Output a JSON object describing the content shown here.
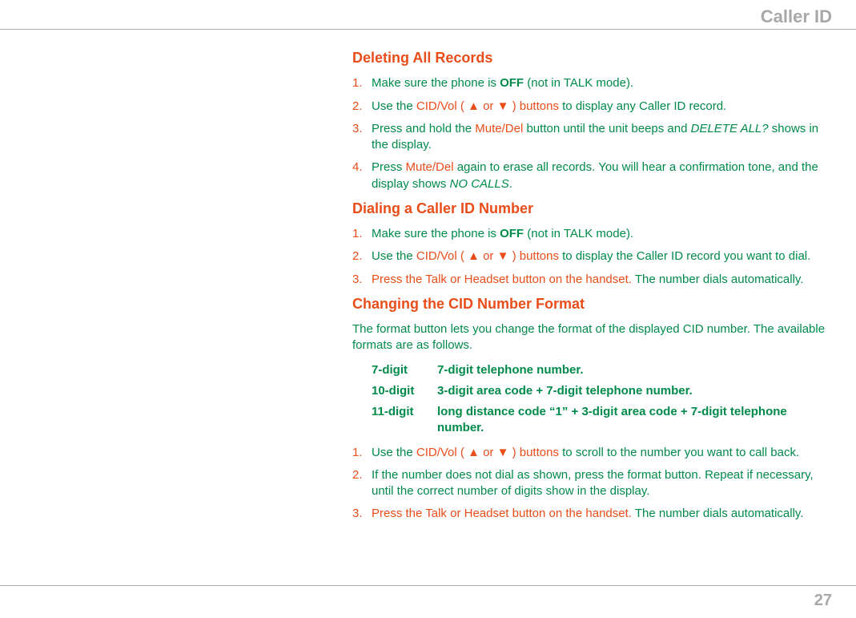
{
  "header": {
    "title": "Caller ID"
  },
  "page_number": "27",
  "sections": {
    "deleting": {
      "heading": "Deleting All Records",
      "items": {
        "1": {
          "num": "1.",
          "pre": "Make sure the phone is ",
          "bold1": "OFF",
          "post": " (not in TALK mode)."
        },
        "2": {
          "num": "2.",
          "pre": "Use the ",
          "red": "CID/Vol ( ▲ or ▼ ) buttons",
          "post": " to display any Caller ID record."
        },
        "3": {
          "num": "3.",
          "a": "Press and hold the ",
          "red": "Mute/Del",
          "b": " button until the unit beeps and ",
          "italic": "DELETE ALL?",
          "c": " shows in the display."
        },
        "4": {
          "num": "4.",
          "a": "Press ",
          "red": "Mute/Del",
          "b": " again to erase all records. You will hear a confirmation tone, and the display shows ",
          "italic": "NO CALLS",
          "c": "."
        }
      }
    },
    "dialing": {
      "heading": "Dialing a Caller ID Number",
      "items": {
        "1": {
          "num": "1.",
          "pre": "Make sure the phone is ",
          "bold1": "OFF",
          "post": " (not in TALK mode)."
        },
        "2": {
          "num": "2.",
          "pre": "Use the ",
          "red": "CID/Vol ( ▲ or ▼ ) buttons",
          "post": " to display the Caller ID record you want to dial."
        },
        "3": {
          "num": "3.",
          "red": "Press the Talk or Headset button on the handset.",
          "post": " The number dials automatically."
        }
      }
    },
    "changing": {
      "heading": "Changing the CID Number Format",
      "intro": "The format button lets you change the format of the displayed CID number. The available formats are as follows.",
      "formats": {
        "r1": {
          "label": "7-digit",
          "desc": "7-digit telephone number."
        },
        "r2": {
          "label": "10-digit",
          "desc": "3-digit area code + 7-digit telephone number."
        },
        "r3": {
          "label": "11-digit",
          "desc": "long distance code “1” + 3-digit area code + 7-digit telephone number."
        }
      },
      "items": {
        "1": {
          "num": "1.",
          "pre": "Use the ",
          "red": "CID/Vol ( ▲ or ▼ ) buttons",
          "post": " to scroll to the number you want to call back."
        },
        "2": {
          "num": "2.",
          "text": "If the number does not dial as shown, press the format button. Repeat if necessary, until the correct number of digits show in the display."
        },
        "3": {
          "num": "3.",
          "red": "Press the Talk or Headset button on the handset.",
          "post": " The number dials automatically."
        }
      }
    }
  }
}
